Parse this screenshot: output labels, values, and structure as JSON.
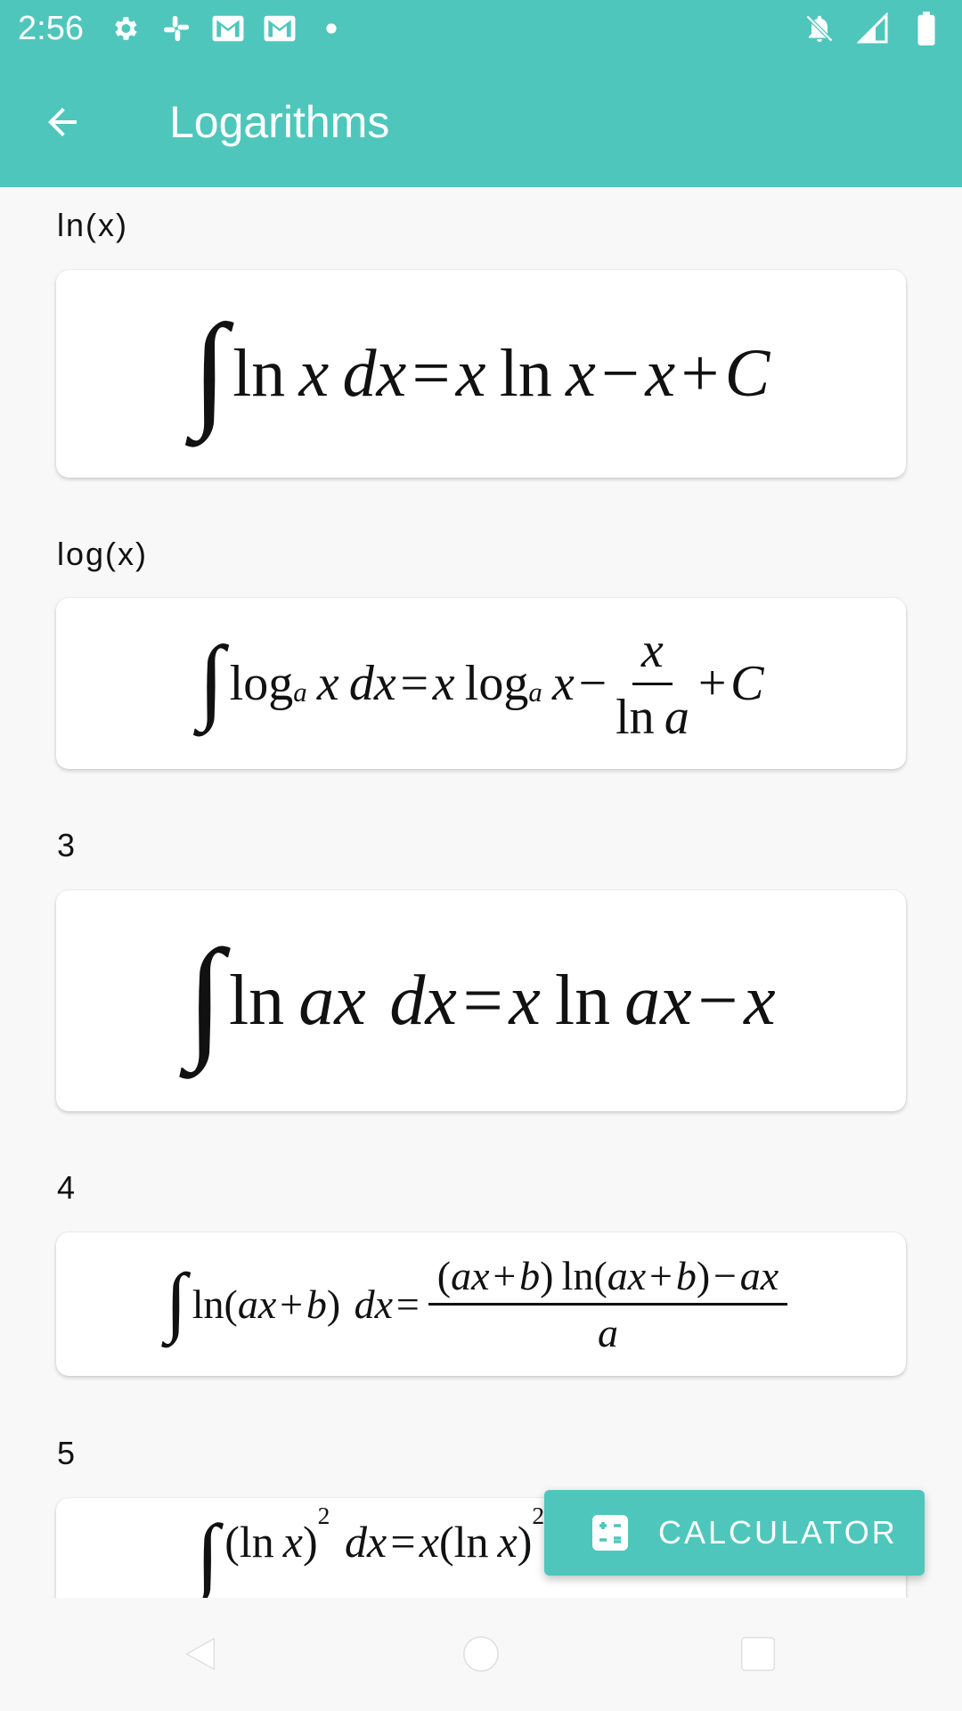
{
  "status_bar": {
    "time": "2:56",
    "icons_left": [
      "settings-icon",
      "slack-icon",
      "gmail-icon",
      "gmail-icon",
      "dot-icon"
    ],
    "icons_right": [
      "notifications-off-icon",
      "signal-icon",
      "battery-icon"
    ]
  },
  "app_bar": {
    "title": "Logarithms",
    "back_icon": "arrow-back-icon"
  },
  "sections": [
    {
      "label": "ln(x)"
    },
    {
      "label": "log(x)"
    },
    {
      "label": "3"
    },
    {
      "label": "4"
    },
    {
      "label": "5"
    }
  ],
  "fab": {
    "label": "CALCULATOR",
    "icon": "calculator-icon"
  },
  "nav": [
    "back-triangle-icon",
    "home-circle-icon",
    "recents-square-icon"
  ],
  "colors": {
    "primary": "#4fc6bc",
    "background": "#f8f8f8",
    "card": "#ffffff"
  }
}
